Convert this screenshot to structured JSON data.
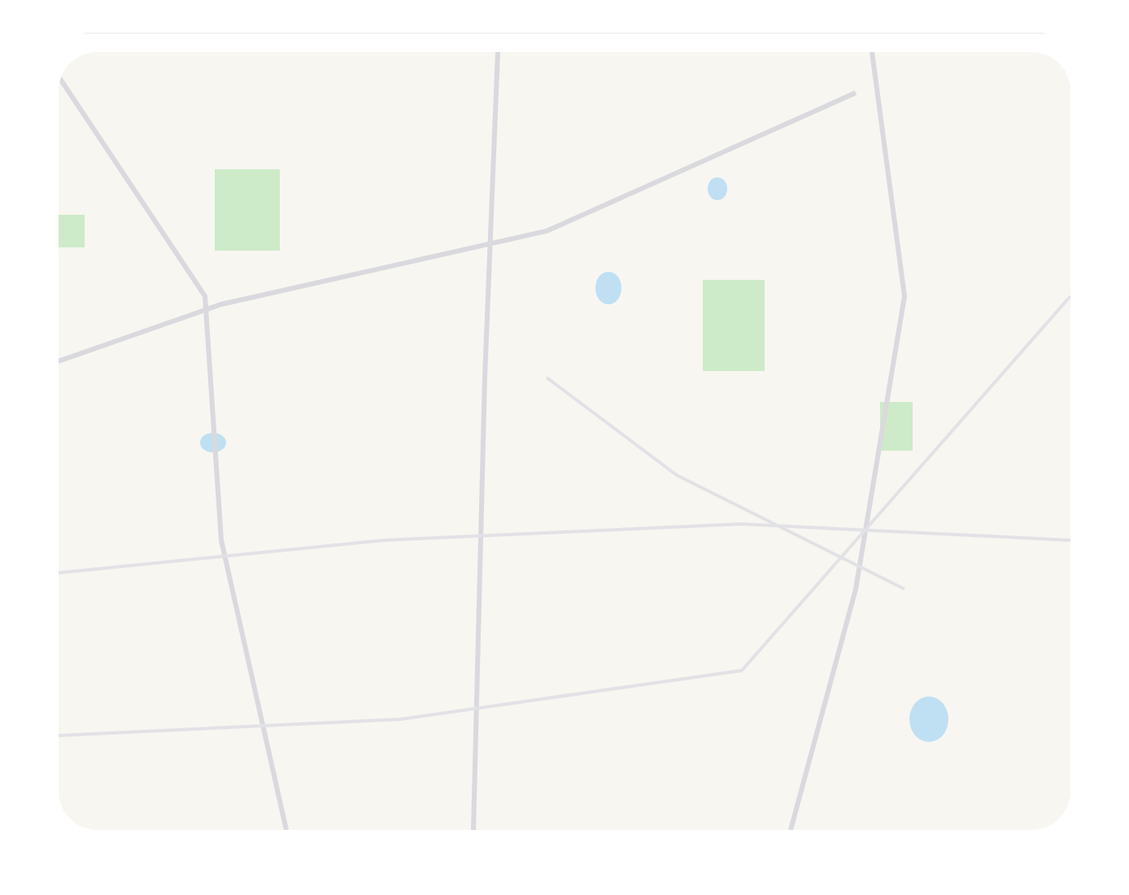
{
  "map": {
    "kind": "street-map"
  }
}
